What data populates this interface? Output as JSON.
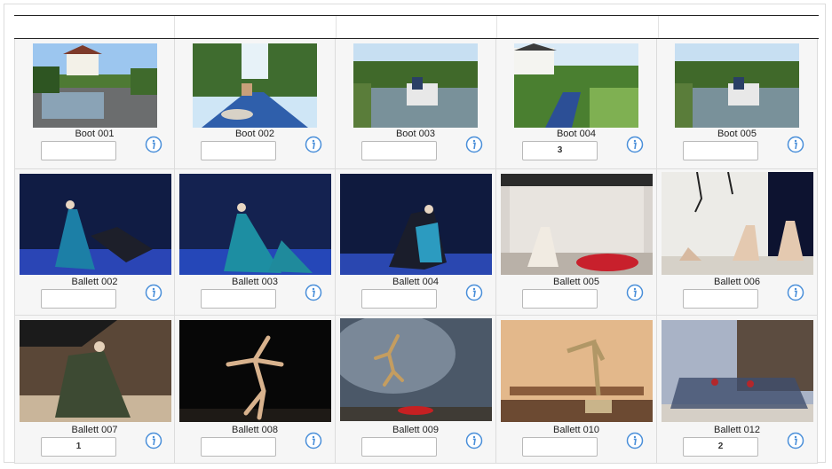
{
  "items": [
    {
      "label": "Boot 001",
      "value": ""
    },
    {
      "label": "Boot 002",
      "value": ""
    },
    {
      "label": "Boot 003",
      "value": ""
    },
    {
      "label": "Boot 004",
      "value": "3"
    },
    {
      "label": "Boot 005",
      "value": ""
    },
    {
      "label": "Ballett 002",
      "value": ""
    },
    {
      "label": "Ballett 003",
      "value": ""
    },
    {
      "label": "Ballett 004",
      "value": ""
    },
    {
      "label": "Ballett 005",
      "value": ""
    },
    {
      "label": "Ballett 006",
      "value": ""
    },
    {
      "label": "Ballett 007",
      "value": "1"
    },
    {
      "label": "Ballett 008",
      "value": ""
    },
    {
      "label": "Ballett 009",
      "value": ""
    },
    {
      "label": "Ballett 010",
      "value": ""
    },
    {
      "label": "Ballett 012",
      "value": "2"
    }
  ],
  "colors": {
    "info": "#4a8fd9",
    "border": "#dcdcdc",
    "cell_bg": "#f6f6f6"
  },
  "icons": {
    "info": "info-icon"
  }
}
